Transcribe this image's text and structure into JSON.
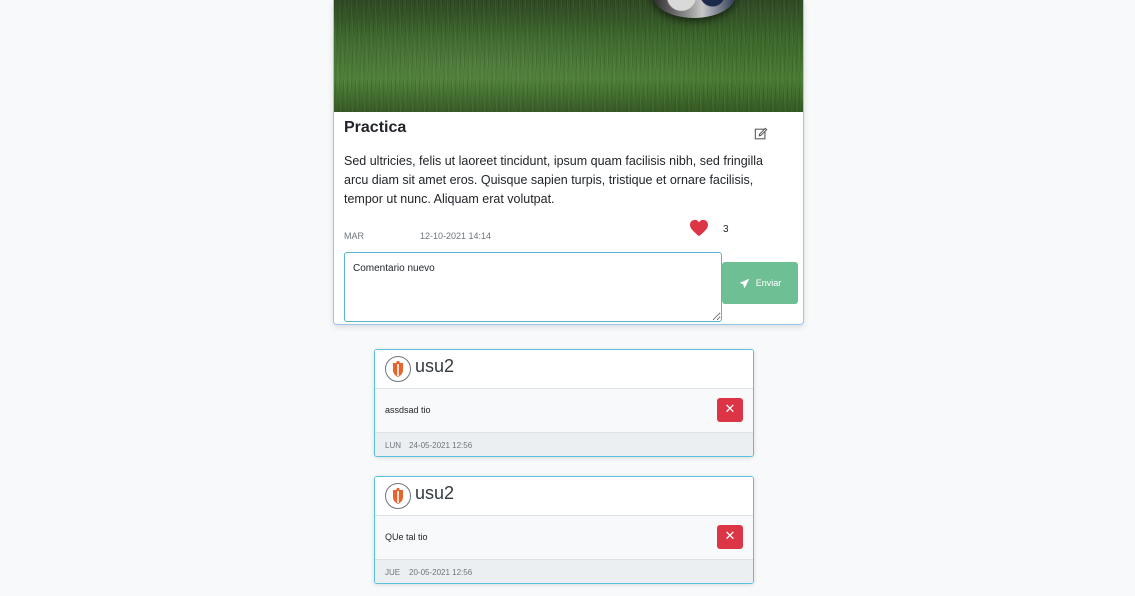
{
  "post": {
    "title": "Practica",
    "body": "Sed ultricies, felis ut laoreet tincidunt, ipsum quam facilisis nibh, sed fringilla arcu diam sit amet eros. Quisque sapien turpis, tristique et ornare facilisis, tempor ut nunc. Aliquam erat volutpat.",
    "day": "MAR",
    "date": "12-10-2021 14:14",
    "likes": "3",
    "comment_placeholder": "Comentario nuevo",
    "send_label": "Enviar",
    "colors": {
      "heart": "#dc3545",
      "send": "#6fbf95",
      "accent": "#5bc0de"
    }
  },
  "comments": [
    {
      "user": "usu2",
      "text": "assdsad tio",
      "day": "LUN",
      "date": "24-05-2021 12:56",
      "delete_label": "✕"
    },
    {
      "user": "usu2",
      "text": "QUe tal tio",
      "day": "JUE",
      "date": "20-05-2021 12:56",
      "delete_label": "✕"
    }
  ],
  "icons": {
    "edit": "edit-icon",
    "heart": "heart-icon",
    "send": "paper-plane-icon",
    "avatar": "team-crest-icon",
    "delete": "close-icon"
  }
}
